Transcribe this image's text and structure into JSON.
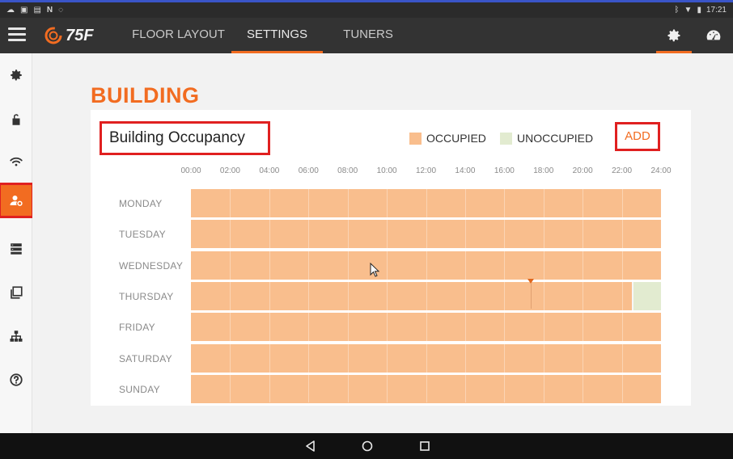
{
  "status_bar": {
    "time": "17:21"
  },
  "app": {
    "logo_text": "75F",
    "tabs": [
      {
        "label": "FLOOR LAYOUT",
        "active": false
      },
      {
        "label": "SETTINGS",
        "active": true
      },
      {
        "label": "TUNERS",
        "active": false
      }
    ]
  },
  "sidebar": {
    "items": [
      {
        "icon": "gear-icon",
        "active": false
      },
      {
        "icon": "unlock-icon",
        "active": false
      },
      {
        "icon": "wifi-icon",
        "active": false
      },
      {
        "icon": "user-settings-icon",
        "active": true
      },
      {
        "icon": "server-icon",
        "active": false
      },
      {
        "icon": "copy-icon",
        "active": false
      },
      {
        "icon": "network-icon",
        "active": false
      },
      {
        "icon": "help-icon",
        "active": false
      }
    ]
  },
  "page": {
    "title": "BUILDING"
  },
  "schedule": {
    "title": "Building Occupancy",
    "legend": [
      {
        "label": "OCCUPIED",
        "color": "#f9be8d"
      },
      {
        "label": "UNOCCUPIED",
        "color": "#e2ebd0"
      }
    ],
    "add_label": "ADD",
    "hours": [
      "00:00",
      "02:00",
      "04:00",
      "06:00",
      "08:00",
      "10:00",
      "12:00",
      "14:00",
      "16:00",
      "18:00",
      "20:00",
      "22:00",
      "24:00"
    ],
    "days": [
      {
        "label": "MONDAY",
        "occupied": [
          [
            0,
            24
          ]
        ]
      },
      {
        "label": "TUESDAY",
        "occupied": [
          [
            0,
            24
          ]
        ]
      },
      {
        "label": "WEDNESDAY",
        "occupied": [
          [
            0,
            24
          ]
        ]
      },
      {
        "label": "THURSDAY",
        "occupied": [
          [
            0,
            22.5
          ]
        ],
        "unoccupied": [
          [
            22.5,
            24
          ]
        ]
      },
      {
        "label": "FRIDAY",
        "occupied": [
          [
            0,
            24
          ]
        ]
      },
      {
        "label": "SATURDAY",
        "occupied": [
          [
            0,
            24
          ]
        ]
      },
      {
        "label": "SUNDAY",
        "occupied": [
          [
            0,
            24
          ]
        ]
      }
    ],
    "current_time_hour": 17.35
  },
  "colors": {
    "accent": "#f26c21",
    "highlight": "#e02020",
    "appbar": "#333333"
  }
}
